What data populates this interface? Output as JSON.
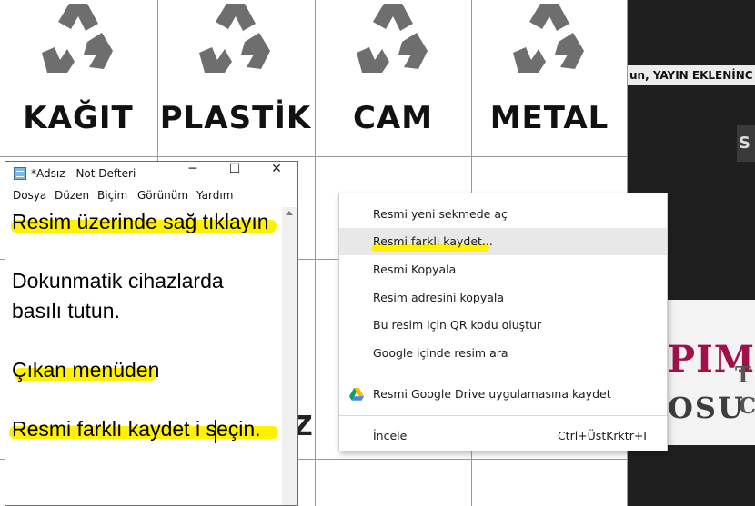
{
  "sheet": {
    "bins": [
      {
        "label": "KAĞIT"
      },
      {
        "label": "PLASTİK"
      },
      {
        "label": "CAM"
      },
      {
        "label": "METAL"
      }
    ],
    "lower_char": "Z"
  },
  "site": {
    "ticker": "un, YAYIN EKLENİNC",
    "search_char": "S",
    "brand_line1": "PIM",
    "brand_line2": "OSU",
    "side1": "T",
    "side2": "C"
  },
  "notepad": {
    "title": "*Adsız - Not Defteri",
    "window_buttons": {
      "minimize": "─",
      "maximize": "☐",
      "close": "✕"
    },
    "menu": [
      "Dosya",
      "Düzen",
      "Biçim",
      "Görünüm",
      "Yardım"
    ],
    "lines": [
      "Resim üzerinde sağ tıklayın",
      "",
      "Dokunmatik cihazlarda",
      "basılı tutun.",
      "",
      "Çıkan menüden",
      "",
      "Resmi farklı kaydet i seçin."
    ]
  },
  "context_menu": {
    "items": [
      {
        "label": "Resmi yeni sekmede aç",
        "shortcut": ""
      },
      {
        "label": "Resmi farklı kaydet...",
        "shortcut": ""
      },
      {
        "label": "Resmi Kopyala",
        "shortcut": ""
      },
      {
        "label": "Resim adresini kopyala",
        "shortcut": ""
      },
      {
        "label": "Bu resim için QR kodu oluştur",
        "shortcut": ""
      },
      {
        "label": "Google içinde resim ara",
        "shortcut": ""
      },
      {
        "label": "Resmi Google Drive uygulamasına kaydet",
        "shortcut": "",
        "icon": "google-drive-icon"
      },
      {
        "label": "İncele",
        "shortcut": "Ctrl+ÜstKrktr+I"
      }
    ],
    "highlight_color": "#fff200"
  }
}
